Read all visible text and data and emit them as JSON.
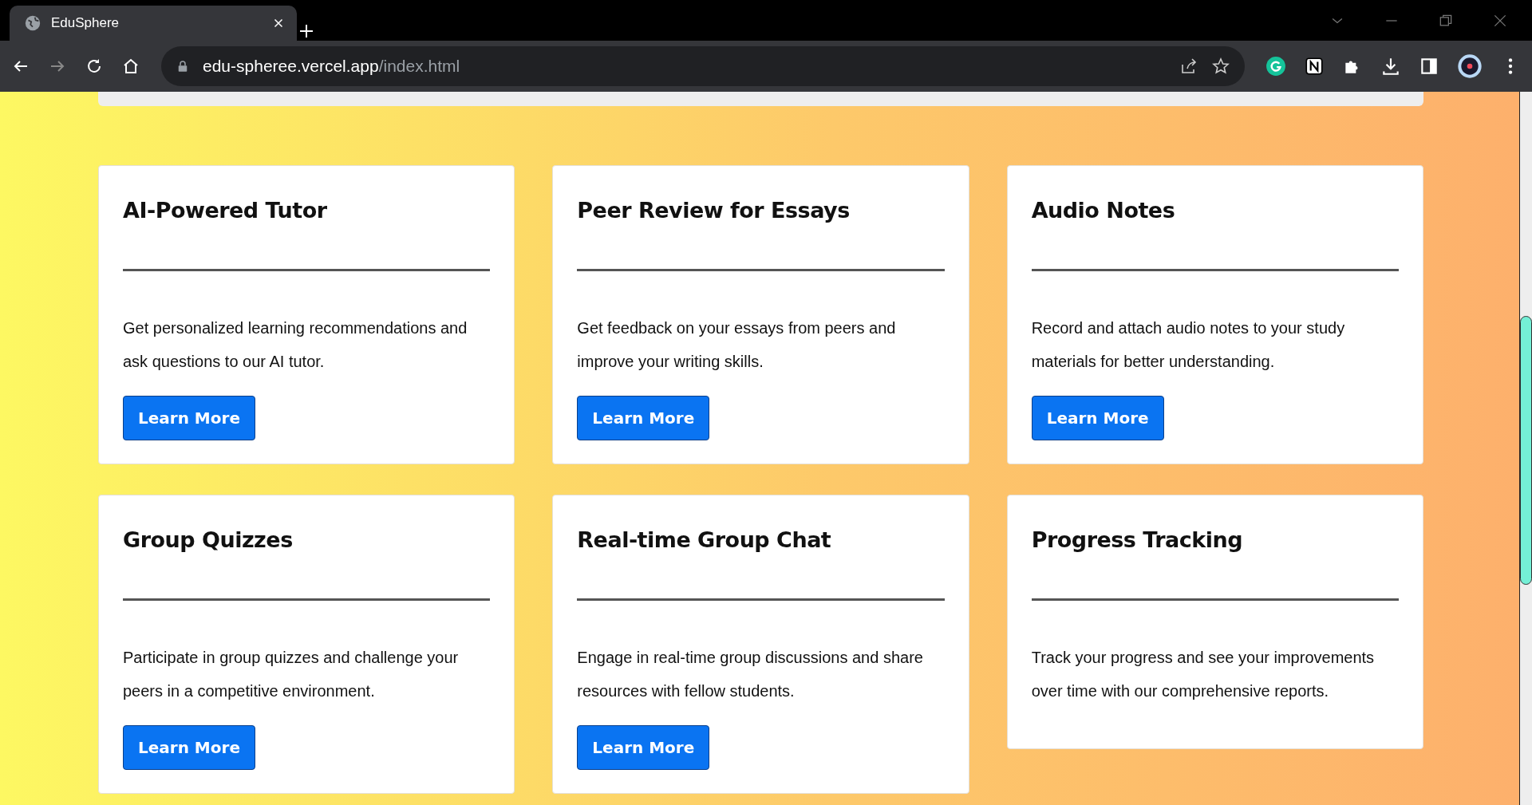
{
  "browser": {
    "tab_title": "EduSphere",
    "url_host": "edu-spheree.vercel.app",
    "url_path": "/index.html"
  },
  "features": [
    {
      "title": "AI-Powered Tutor",
      "description": "Get personalized learning recommendations and ask questions to our AI tutor.",
      "button": "Learn More"
    },
    {
      "title": "Peer Review for Essays",
      "description": "Get feedback on your essays from peers and improve your writing skills.",
      "button": "Learn More"
    },
    {
      "title": "Audio Notes",
      "description": "Record and attach audio notes to your study materials for better understanding.",
      "button": "Learn More"
    },
    {
      "title": "Group Quizzes",
      "description": "Participate in group quizzes and challenge your peers in a competitive environment.",
      "button": "Learn More"
    },
    {
      "title": "Real-time Group Chat",
      "description": "Engage in real-time group discussions and share resources with fellow students.",
      "button": "Learn More"
    },
    {
      "title": "Progress Tracking",
      "description": "Track your progress and see your improvements over time with our comprehensive reports."
    }
  ]
}
